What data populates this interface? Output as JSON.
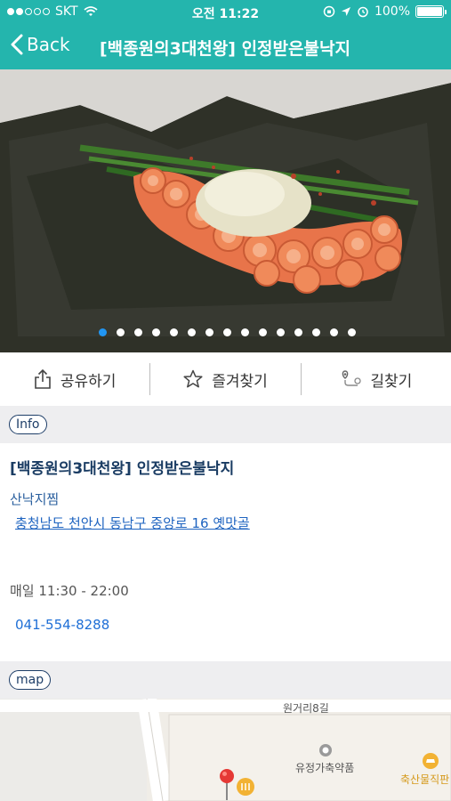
{
  "status": {
    "carrier": "SKT",
    "time": "오전 11:22",
    "battery": "100%",
    "battery_level": 1.0
  },
  "nav": {
    "back_label": "Back",
    "title": "[백종원의3대천왕] 인정받은불낙지"
  },
  "gallery": {
    "photo_count": 15,
    "active_index": 0
  },
  "actions": {
    "share": "공유하기",
    "favorite": "즐겨찾기",
    "directions": "길찾기"
  },
  "info": {
    "header": "Info",
    "name": "[백종원의3대천왕] 인정받은불낙지",
    "category": "산낙지찜",
    "address": "충청남도 천안시 동남구 중앙로 16 옛맛골",
    "hours": "매일 11:30 - 22:00",
    "phone": "041-554-8288"
  },
  "map": {
    "header": "map",
    "road_label": "원거리8길",
    "poi_pharmacy": "유정가축약품",
    "poi_market": "축산물직판"
  },
  "colors": {
    "accent": "#24b5ad",
    "link": "#1f64c0",
    "pager_active": "#2196f3"
  }
}
